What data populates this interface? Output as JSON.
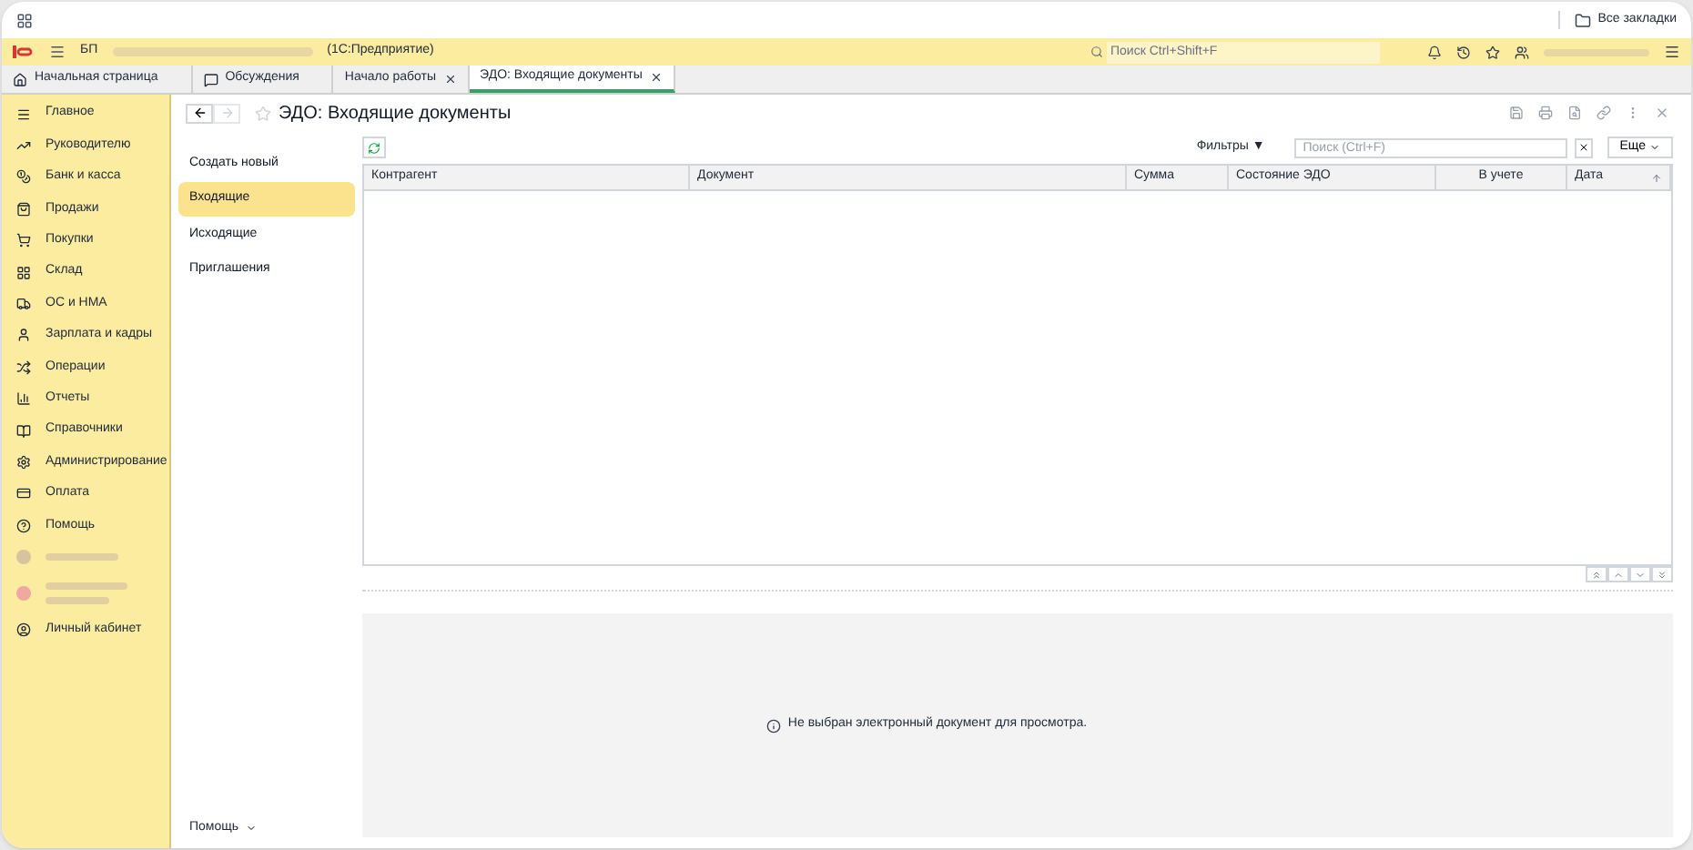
{
  "top_bar": {
    "bookmarks": "Все закладки"
  },
  "header": {
    "app_short": "БП",
    "app_name": "(1С:Предприятие)",
    "search_placeholder": "Поиск Ctrl+Shift+F"
  },
  "tabs": [
    {
      "label": "Начальная страница",
      "kind": "home",
      "closable": false,
      "selected": false
    },
    {
      "label": "Обсуждения",
      "kind": "chat",
      "closable": false,
      "selected": false
    },
    {
      "label": "Начало работы",
      "kind": "document",
      "closable": true,
      "selected": false
    },
    {
      "label": "ЭДО: Входящие документы",
      "kind": "document",
      "closable": true,
      "selected": true
    }
  ],
  "sidebar": {
    "items": [
      {
        "label": "Главное"
      },
      {
        "label": "Руководителю"
      },
      {
        "label": "Банк и касса"
      },
      {
        "label": "Продажи"
      },
      {
        "label": "Покупки"
      },
      {
        "label": "Склад"
      },
      {
        "label": "ОС и НМА"
      },
      {
        "label": "Зарплата и кадры"
      },
      {
        "label": "Операции"
      },
      {
        "label": "Отчеты"
      },
      {
        "label": "Справочники"
      },
      {
        "label": "Администрирование"
      },
      {
        "label": "Оплата"
      },
      {
        "label": "Помощь"
      }
    ],
    "account": "Личный кабинет"
  },
  "form": {
    "title": "ЭДО: Входящие документы",
    "sections": [
      {
        "label": "Создать новый",
        "selected": false
      },
      {
        "label": "Входящие",
        "selected": true
      },
      {
        "label": "Исходящие",
        "selected": false
      },
      {
        "label": "Приглашения",
        "selected": false
      }
    ],
    "filters": "Фильтры ▼",
    "search_placeholder": "Поиск (Ctrl+F)",
    "more": "Еще",
    "table": {
      "columns": [
        {
          "label": "Контрагент",
          "sorted": false
        },
        {
          "label": "Документ",
          "sorted": false
        },
        {
          "label": "Сумма",
          "sorted": false
        },
        {
          "label": "Состояние ЭДО",
          "sorted": false
        },
        {
          "label": "В учете",
          "sorted": false
        },
        {
          "label": "Дата",
          "sorted": true
        }
      ]
    },
    "empty_message": "Не выбран электронный документ для просмотра.",
    "help": "Помощь"
  }
}
